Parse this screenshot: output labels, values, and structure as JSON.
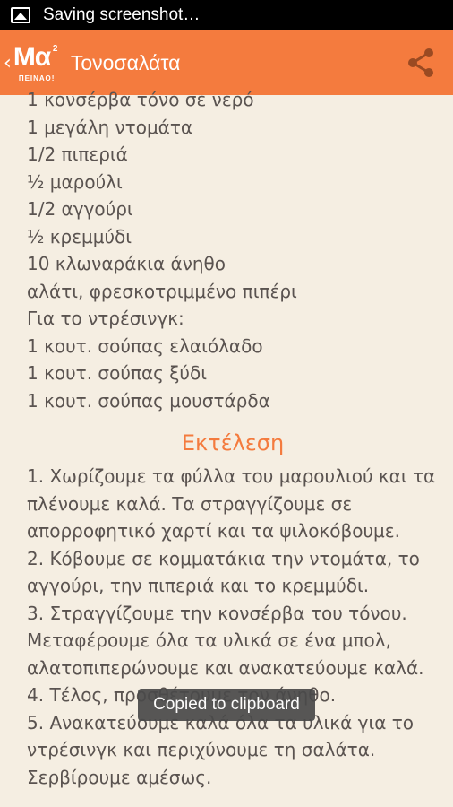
{
  "status_bar": {
    "icon": "image-icon",
    "text": "Saving screenshot…"
  },
  "action_bar": {
    "back_glyph": "‹",
    "logo_main": "Μα",
    "logo_sup": "2",
    "logo_sub": "ΠΕΙΝΑΟ!",
    "title": "Τονοσαλάτα",
    "share_icon": "share-icon",
    "color": "#f47b3e"
  },
  "ingredients": [
    "1 κονσέρβα τόνο σε νερό",
    "1 μεγάλη ντομάτα",
    "1/2 πιπεριά",
    "½ μαρούλι",
    "1/2 αγγούρι",
    "½ κρεμμύδι",
    "10 κλωναράκια άνηθο",
    "αλάτι, φρεσκοτριμμένο πιπέρι",
    "Για το ντρέσινγκ:",
    "1 κουτ. σούπας ελαιόλαδο",
    "1 κουτ. σούπας ξύδι",
    "1 κουτ. σούπας μουστάρδα"
  ],
  "section_title": "Εκτέλεση",
  "steps": [
    "1. Χωρίζουμε τα φύλλα του μαρουλιού και τα πλένουμε καλά. Τα στραγγίζουμε σε απορροφητικό χαρτί και τα ψιλοκόβουμε.",
    "2. Κόβουμε σε κομματάκια την ντομάτα, το αγγούρι, την πιπεριά και το κρεμμύδι.",
    "3. Στραγγίζουμε την κονσέρβα του τόνου. Μεταφέρουμε όλα τα υλικά σε ένα μπολ, αλατοπιπερώνουμε και ανακατεύουμε καλά.",
    "4. Τέλος, προσθέτουμε τον άνηθο.",
    "5. Ανακατεύουμε καλά όλα τα υλικά για το ντρέσινγκ και περιχύνουμε τη σαλάτα. Σερβίρουμε αμέσως."
  ],
  "toast": "Copied to clipboard"
}
